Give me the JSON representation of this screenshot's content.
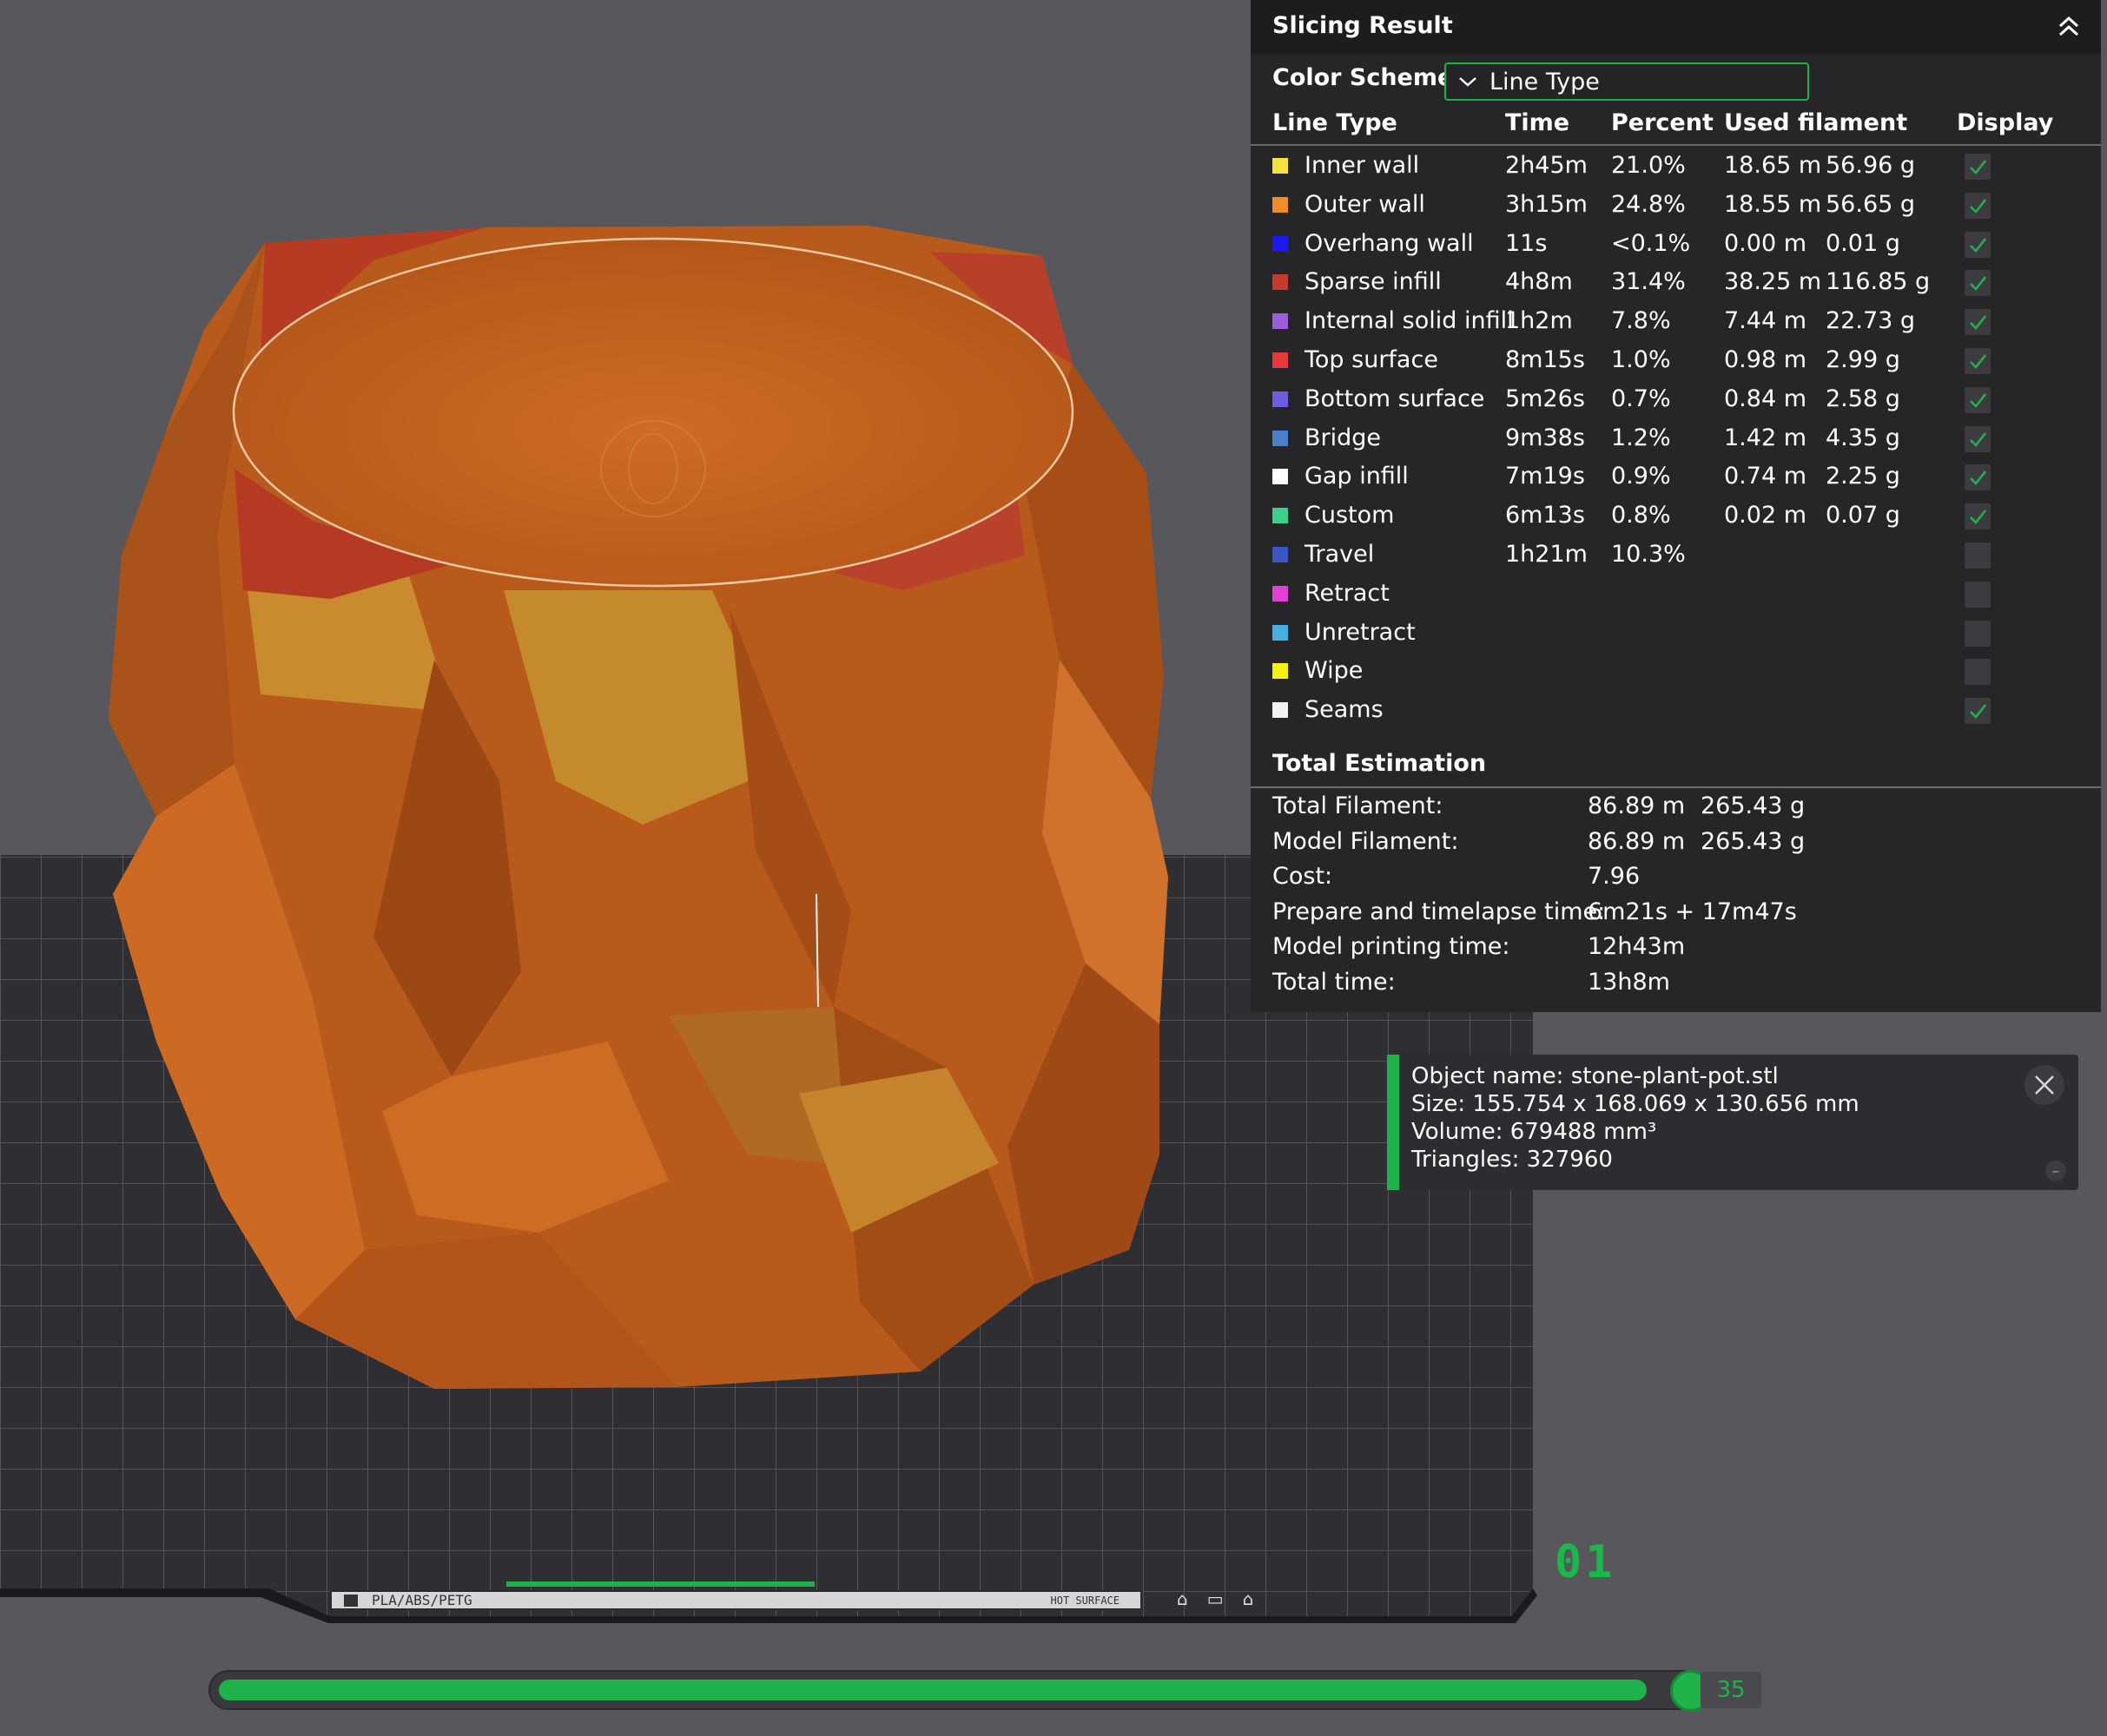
{
  "slicing_result": {
    "title": "Slicing Result",
    "color_scheme_label": "Color Scheme",
    "color_scheme_value": "Line Type",
    "columns": {
      "line_type": "Line Type",
      "time": "Time",
      "percent": "Percent",
      "used_filament": "Used filament",
      "display": "Display"
    },
    "rows": [
      {
        "name": "Inner wall",
        "color": "#f5e23c",
        "time": "2h45m",
        "percent": "21.0%",
        "length": "18.65 m",
        "weight": "56.96 g",
        "display": true
      },
      {
        "name": "Outer wall",
        "color": "#f08c2a",
        "time": "3h15m",
        "percent": "24.8%",
        "length": "18.55 m",
        "weight": "56.65 g",
        "display": true
      },
      {
        "name": "Overhang wall",
        "color": "#1a1aef",
        "time": "11s",
        "percent": "<0.1%",
        "length": "0.00 m",
        "weight": "0.01 g",
        "display": true
      },
      {
        "name": "Sparse infill",
        "color": "#c83a2c",
        "time": "4h8m",
        "percent": "31.4%",
        "length": "38.25 m",
        "weight": "116.85 g",
        "display": true
      },
      {
        "name": "Internal solid infill",
        "color": "#9a5ed6",
        "time": "1h2m",
        "percent": "7.8%",
        "length": "7.44 m",
        "weight": "22.73 g",
        "display": true
      },
      {
        "name": "Top surface",
        "color": "#e83a3a",
        "time": "8m15s",
        "percent": "1.0%",
        "length": "0.98 m",
        "weight": "2.99 g",
        "display": true
      },
      {
        "name": "Bottom surface",
        "color": "#6b5fe0",
        "time": "5m26s",
        "percent": "0.7%",
        "length": "0.84 m",
        "weight": "2.58 g",
        "display": true
      },
      {
        "name": "Bridge",
        "color": "#4a7fc9",
        "time": "9m38s",
        "percent": "1.2%",
        "length": "1.42 m",
        "weight": "4.35 g",
        "display": true
      },
      {
        "name": "Gap infill",
        "color": "#ffffff",
        "time": "7m19s",
        "percent": "0.9%",
        "length": "0.74 m",
        "weight": "2.25 g",
        "display": true
      },
      {
        "name": "Custom",
        "color": "#3ccf86",
        "time": "6m13s",
        "percent": "0.8%",
        "length": "0.02 m",
        "weight": "0.07 g",
        "display": true
      },
      {
        "name": "Travel",
        "color": "#3d54c4",
        "time": "1h21m",
        "percent": "10.3%",
        "length": "",
        "weight": "",
        "display": false
      },
      {
        "name": "Retract",
        "color": "#e23fd6",
        "time": "",
        "percent": "",
        "length": "",
        "weight": "",
        "display": false
      },
      {
        "name": "Unretract",
        "color": "#45b0df",
        "time": "",
        "percent": "",
        "length": "",
        "weight": "",
        "display": false
      },
      {
        "name": "Wipe",
        "color": "#f2f20a",
        "time": "",
        "percent": "",
        "length": "",
        "weight": "",
        "display": false
      },
      {
        "name": "Seams",
        "color": "#f2f2f2",
        "time": "",
        "percent": "",
        "length": "",
        "weight": "",
        "display": true
      }
    ],
    "total_title": "Total Estimation",
    "totals": [
      {
        "label": "Total Filament:",
        "value": "86.89 m",
        "value2": "265.43 g"
      },
      {
        "label": "Model Filament:",
        "value": "86.89 m",
        "value2": "265.43 g"
      },
      {
        "label": "Cost:",
        "value": "7.96",
        "value2": ""
      },
      {
        "label": "Prepare and timelapse time:",
        "value": "6m21s + 17m47s",
        "value2": ""
      },
      {
        "label": "Model printing time:",
        "value": "12h43m",
        "value2": ""
      },
      {
        "label": "Total time:",
        "value": "13h8m",
        "value2": ""
      }
    ]
  },
  "object_info": {
    "name": "Object name: stone-plant-pot.stl",
    "size": "Size: 155.754 x 168.069 x 130.656 mm",
    "volume": "Volume: 679488 mm³",
    "triangles": "Triangles: 327960"
  },
  "plate": {
    "number": "01",
    "strip_text": "PLA/ABS/PETG",
    "surface_text": "HOT SURFACE"
  },
  "layer_slider": {
    "value": "35",
    "fill_fraction": 0.97
  },
  "colors": {
    "accent": "#1fb14a",
    "model": "#c4621c",
    "panel_bg": "#262629",
    "viewport_bg": "#58585c"
  },
  "icons": {
    "collapse": "double-chevron-up-icon",
    "dropdown": "chevron-down-icon",
    "check": "check-icon",
    "close": "close-icon",
    "minus": "minus-icon"
  }
}
